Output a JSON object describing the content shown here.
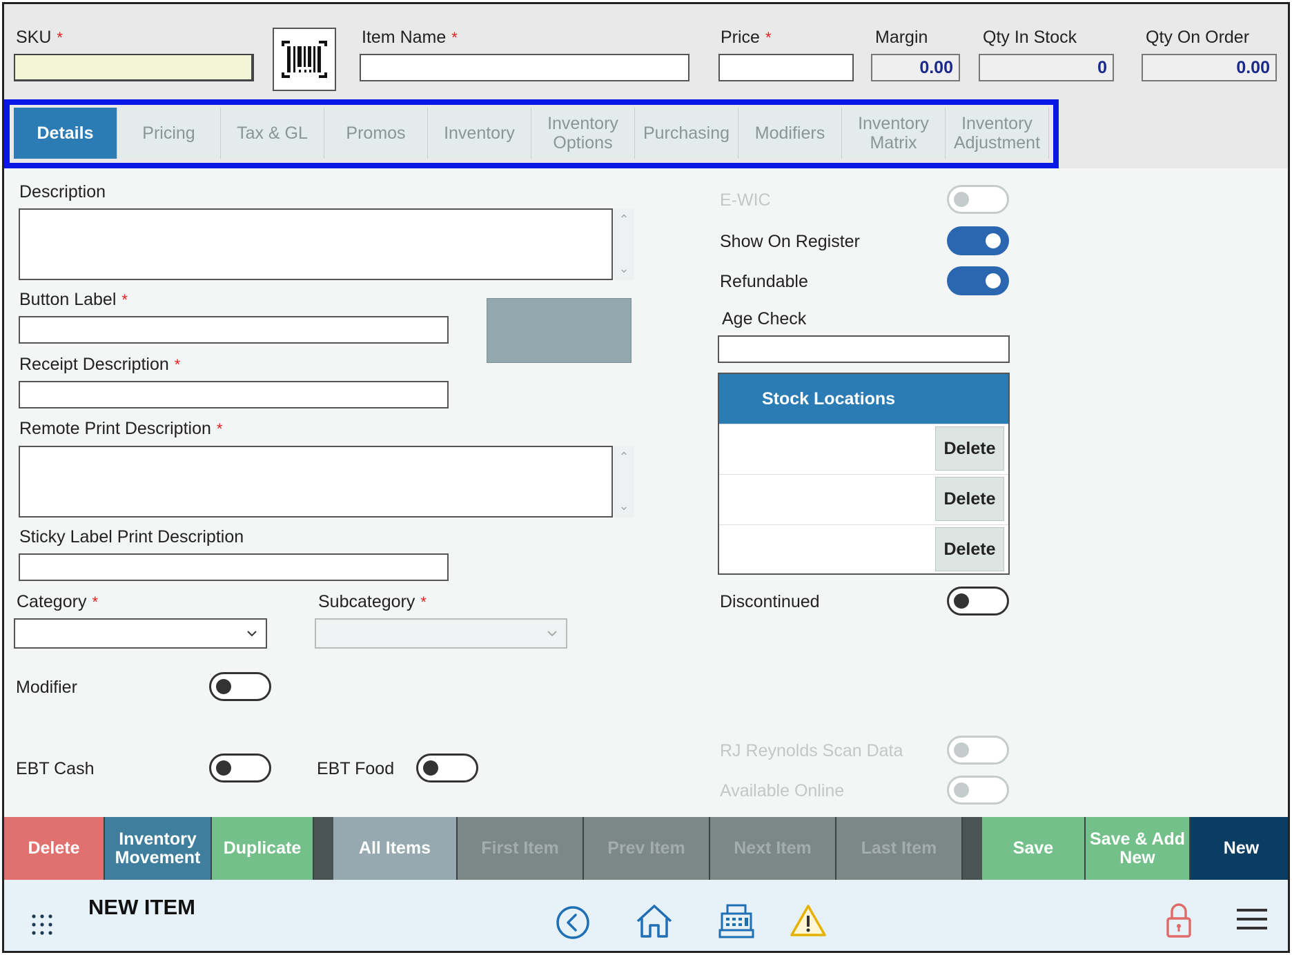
{
  "header": {
    "sku_label": "SKU",
    "item_name_label": "Item Name",
    "price_label": "Price",
    "margin_label": "Margin",
    "margin_value": "0.00",
    "qty_in_stock_label": "Qty In Stock",
    "qty_in_stock_value": "0",
    "qty_on_order_label": "Qty On Order",
    "qty_on_order_value": "0.00",
    "required_mark": "*"
  },
  "tabs": [
    {
      "label": "Details",
      "active": true
    },
    {
      "label": "Pricing"
    },
    {
      "label": "Tax & GL"
    },
    {
      "label": "Promos"
    },
    {
      "label": "Inventory"
    },
    {
      "label": "Inventory Options"
    },
    {
      "label": "Purchasing"
    },
    {
      "label": "Modifiers"
    },
    {
      "label": "Inventory Matrix"
    },
    {
      "label": "Inventory Adjustment"
    }
  ],
  "details": {
    "description_label": "Description",
    "button_label_label": "Button Label",
    "receipt_description_label": "Receipt Description",
    "remote_print_description_label": "Remote Print Description",
    "sticky_label_print_description_label": "Sticky Label Print Description",
    "category_label": "Category",
    "subcategory_label": "Subcategory",
    "modifier_label": "Modifier",
    "ebt_cash_label": "EBT Cash",
    "ebt_food_label": "EBT Food",
    "ewic_label": "E-WIC",
    "show_on_register_label": "Show On Register",
    "refundable_label": "Refundable",
    "age_check_label": "Age Check",
    "discontinued_label": "Discontinued",
    "rj_reynolds_label": "RJ Reynolds Scan Data",
    "available_online_label": "Available Online"
  },
  "stock_locations": {
    "title": "Stock Locations",
    "rows": [
      {
        "delete_label": "Delete"
      },
      {
        "delete_label": "Delete"
      },
      {
        "delete_label": "Delete"
      }
    ]
  },
  "actions": [
    {
      "label": "Delete",
      "color": "#e0716f"
    },
    {
      "label": "Inventory Movement",
      "color": "#3f7e9c"
    },
    {
      "label": "Duplicate",
      "color": "#74c08a"
    },
    {
      "label": "All Items",
      "color": "#95a9ae"
    },
    {
      "label": "First Item",
      "color": "#7b8886"
    },
    {
      "label": "Prev Item",
      "color": "#7b8886"
    },
    {
      "label": "Next Item",
      "color": "#7b8886"
    },
    {
      "label": "Last Item",
      "color": "#7b8886"
    },
    {
      "label": "Save",
      "color": "#74c08a"
    },
    {
      "label": "Save & Add New",
      "color": "#74c08a"
    },
    {
      "label": "New",
      "color": "#0b3d62"
    }
  ],
  "footer": {
    "title": "NEW ITEM",
    "icons": [
      "apps-grid-icon",
      "back-circle-icon",
      "home-icon",
      "register-icon",
      "warning-icon",
      "lock-icon",
      "menu-icon"
    ]
  },
  "colors": {
    "accent": "#2b7cb5",
    "highlight_frame": "#0a18e6",
    "toggle_on": "#2b66b0"
  }
}
